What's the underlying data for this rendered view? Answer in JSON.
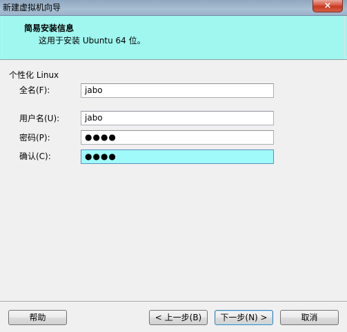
{
  "window": {
    "title": "新建虚拟机向导",
    "close_symbol": "×"
  },
  "banner": {
    "heading": "简易安装信息",
    "subheading": "这用于安装 Ubuntu 64 位。"
  },
  "personalize": {
    "group_label": "个性化 Linux",
    "full_name_label": "全名(F):",
    "full_name_value": "jabo",
    "username_label": "用户名(U):",
    "username_value": "jabo",
    "password_label": "密码(P):",
    "password_mask": "●●●●",
    "confirm_label": "确认(C):",
    "confirm_mask": "●●●●"
  },
  "buttons": {
    "help": "帮助",
    "back": "< 上一步(B)",
    "next": "下一步(N) >",
    "cancel": "取消"
  },
  "colors": {
    "banner_bg": "#9ff7ef",
    "focused_input_bg": "#a0fafa",
    "dialog_bg": "#f0f0f0"
  }
}
